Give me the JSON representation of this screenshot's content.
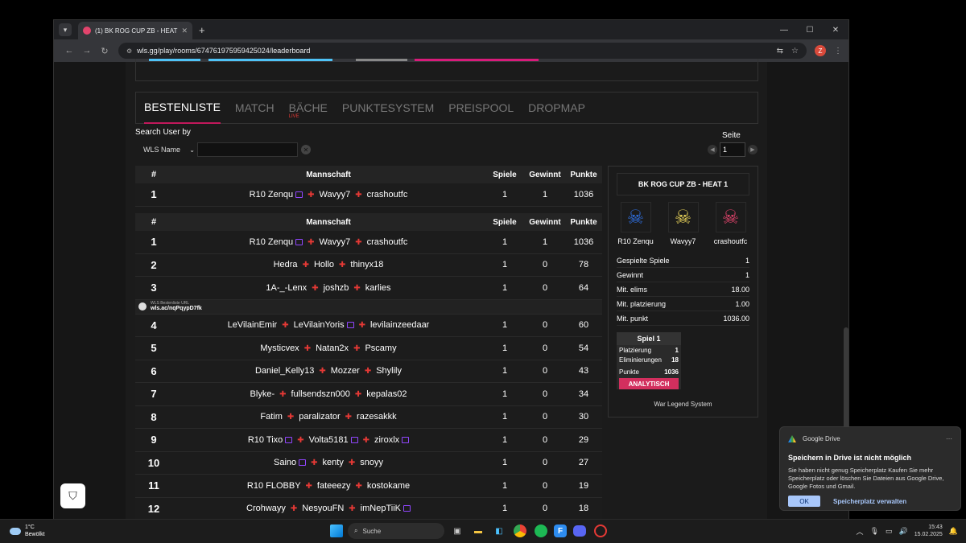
{
  "browser": {
    "tab_title": "(1) BK ROG CUP ZB - HEAT 1 - W",
    "url": "wls.gg/play/rooms/674761975959425024/leaderboard",
    "profile_initial": "Z"
  },
  "nav_tabs": [
    {
      "label": "BESTENLISTE",
      "active": true
    },
    {
      "label": "MATCH"
    },
    {
      "label": "BÄCHE",
      "badge": "LIVE"
    },
    {
      "label": "PUNKTESYSTEM"
    },
    {
      "label": "PREISPOOL"
    },
    {
      "label": "DROPMAP"
    }
  ],
  "search": {
    "label": "Search User by",
    "select_value": "WLS Name",
    "input_value": ""
  },
  "pagination": {
    "label": "Seite",
    "value": "1"
  },
  "table_headers": {
    "rank": "#",
    "team": "Mannschaft",
    "games": "Spiele",
    "wins": "Gewinnt",
    "points": "Punkte"
  },
  "my_team": [
    {
      "rank": "1",
      "players": [
        {
          "name": "R10 Zenqu",
          "twitch": true
        },
        {
          "name": "Wavyy7"
        },
        {
          "name": "crashoutfc"
        }
      ],
      "games": "1",
      "wins": "1",
      "points": "1036"
    }
  ],
  "leaderboard_top": [
    {
      "rank": "1",
      "players": [
        {
          "name": "R10 Zenqu",
          "twitch": true
        },
        {
          "name": "Wavyy7"
        },
        {
          "name": "crashoutfc"
        }
      ],
      "games": "1",
      "wins": "1",
      "points": "1036"
    },
    {
      "rank": "2",
      "players": [
        {
          "name": "Hedra"
        },
        {
          "name": "Hollo"
        },
        {
          "name": "thinyx18"
        }
      ],
      "games": "1",
      "wins": "0",
      "points": "78"
    },
    {
      "rank": "3",
      "players": [
        {
          "name": "1A-_-Lenx"
        },
        {
          "name": "joshzb"
        },
        {
          "name": "karlies"
        }
      ],
      "games": "1",
      "wins": "0",
      "points": "64"
    }
  ],
  "url_banner": {
    "small": "WLS Bestenliste URL",
    "link": "wls.ac/nqPqypD7fk"
  },
  "leaderboard_rest": [
    {
      "rank": "4",
      "players": [
        {
          "name": "LeVilainEmir"
        },
        {
          "name": "LeVilainYoris",
          "twitch": true
        },
        {
          "name": "levilainzeedaar"
        }
      ],
      "games": "1",
      "wins": "0",
      "points": "60"
    },
    {
      "rank": "5",
      "players": [
        {
          "name": "Mysticvex"
        },
        {
          "name": "Natan2x"
        },
        {
          "name": "Pscamy"
        }
      ],
      "games": "1",
      "wins": "0",
      "points": "54"
    },
    {
      "rank": "6",
      "players": [
        {
          "name": "Daniel_Kelly13"
        },
        {
          "name": "Mozzer"
        },
        {
          "name": "Shylily"
        }
      ],
      "games": "1",
      "wins": "0",
      "points": "43"
    },
    {
      "rank": "7",
      "players": [
        {
          "name": "Blyke-"
        },
        {
          "name": "fullsendszn000"
        },
        {
          "name": "kepalas02"
        }
      ],
      "games": "1",
      "wins": "0",
      "points": "34"
    },
    {
      "rank": "8",
      "players": [
        {
          "name": "Fatim"
        },
        {
          "name": "paralizator"
        },
        {
          "name": "razesakkk"
        }
      ],
      "games": "1",
      "wins": "0",
      "points": "30"
    },
    {
      "rank": "9",
      "players": [
        {
          "name": "R10 Tixo",
          "twitch": true
        },
        {
          "name": "Volta5181",
          "twitch": true
        },
        {
          "name": "ziroxlx",
          "twitch": true
        }
      ],
      "games": "1",
      "wins": "0",
      "points": "29"
    },
    {
      "rank": "10",
      "players": [
        {
          "name": "Saino",
          "twitch": true
        },
        {
          "name": "kenty"
        },
        {
          "name": "snoyy"
        }
      ],
      "games": "1",
      "wins": "0",
      "points": "27"
    },
    {
      "rank": "11",
      "players": [
        {
          "name": "R10 FLOBBY"
        },
        {
          "name": "fateeezy"
        },
        {
          "name": "kostokame"
        }
      ],
      "games": "1",
      "wins": "0",
      "points": "19"
    },
    {
      "rank": "12",
      "players": [
        {
          "name": "Crohwayy"
        },
        {
          "name": "NesyouFN"
        },
        {
          "name": "imNepTiiK",
          "twitch": true
        }
      ],
      "games": "1",
      "wins": "0",
      "points": "18"
    }
  ],
  "sidecard": {
    "title": "BK ROG CUP ZB - HEAT 1",
    "players": [
      {
        "name": "R10 Zenqu",
        "color": "#2f6fe0"
      },
      {
        "name": "Wavyy7",
        "color": "#e8d35a"
      },
      {
        "name": "crashoutfc",
        "color": "#e2446c"
      }
    ],
    "stats": [
      {
        "label": "Gespielte Spiele",
        "value": "1"
      },
      {
        "label": "Gewinnt",
        "value": "1"
      },
      {
        "label": "Mit. elims",
        "value": "18.00"
      },
      {
        "label": "Mit. platzierung",
        "value": "1.00"
      },
      {
        "label": "Mit. punkt",
        "value": "1036.00"
      }
    ],
    "game": {
      "title": "Spiel 1",
      "rows": [
        {
          "label": "Platzierung",
          "value": "1"
        },
        {
          "label": "Eliminierungen",
          "value": "18"
        },
        {
          "label": "Punkte",
          "value": "1036"
        }
      ],
      "button": "ANALYTISCH"
    },
    "footer": "War Legend System"
  },
  "toast": {
    "app": "Google Drive",
    "title": "Speichern in Drive ist nicht möglich",
    "body": "Sie haben nicht genug Speicherplatz Kaufen Sie mehr Speicherplatz oder löschen Sie Dateien aus Google Drive, Google Fotos und Gmail.",
    "ok": "OK",
    "link": "Speicherplatz verwalten"
  },
  "taskbar": {
    "temp": "1°C",
    "condition": "Bewölkt",
    "search": "Suche",
    "time": "15:43",
    "date": "15.02.2025"
  }
}
